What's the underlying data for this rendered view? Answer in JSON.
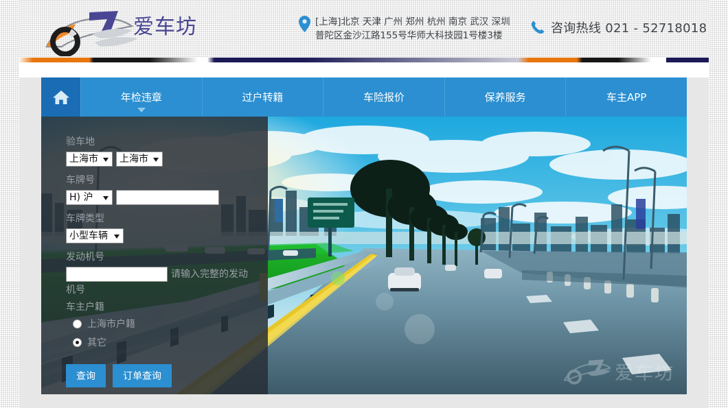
{
  "header": {
    "logo_text": "爱车坊",
    "location_icon": "map-pin-icon",
    "address_line1": "[上海]北京 天津 广州 郑州 杭州 南京 武汉 深圳",
    "address_line2": "普陀区金沙江路155号华师大科技园1号楼3楼",
    "phone_icon": "phone-icon",
    "phone_text": "咨询热线 021 - 52718018"
  },
  "nav": {
    "home_icon": "home-icon",
    "items": [
      {
        "label": "年检违章",
        "has_caret": true
      },
      {
        "label": "过户转籍",
        "has_caret": false
      },
      {
        "label": "车险报价",
        "has_caret": false
      },
      {
        "label": "保养服务",
        "has_caret": false
      },
      {
        "label": "车主APP",
        "has_caret": false
      }
    ]
  },
  "form": {
    "inspection_place_label": "验车地",
    "province_value": "上海市",
    "city_value": "上海市",
    "plate_no_label": "车牌号",
    "plate_prefix_value": "H) 沪",
    "plate_no_value": "",
    "plate_type_label": "车牌类型",
    "plate_type_value": "小型车辆",
    "engine_no_label": "发动机号",
    "engine_no_value": "",
    "engine_hint_part1": "请输入完整的发动",
    "engine_hint_part2": "机号",
    "residence_label": "车主户籍",
    "radio_option1": "上海市户籍",
    "radio_option2": "其它",
    "selected_radio": "其它",
    "submit_label": "查询",
    "order_query_label": "订单查询"
  },
  "hero": {
    "watermark_text": "爱车坊",
    "watermark_icon": "car-logo-icon"
  },
  "colors": {
    "nav_blue": "#2b8fd1",
    "nav_home_blue": "#1a6cb5",
    "button_blue": "#2b8fd1",
    "logo_purple": "#4a4694",
    "accent_orange": "#e8760f",
    "panel_dark": "#282e36"
  }
}
